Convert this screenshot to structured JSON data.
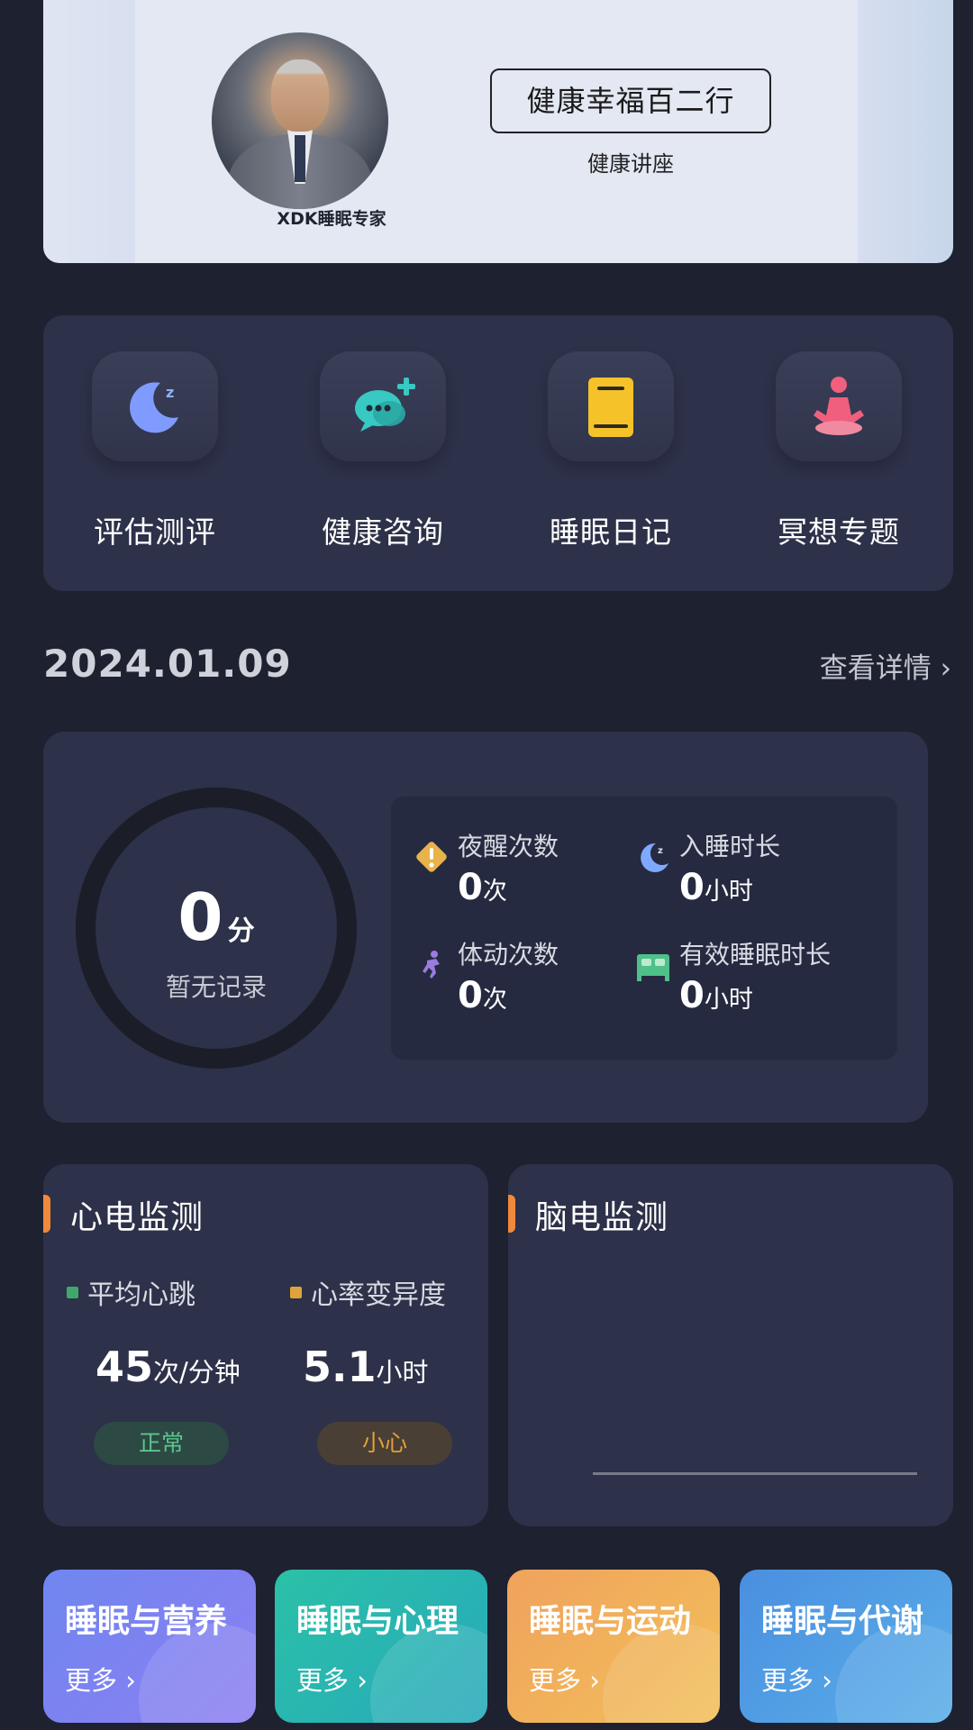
{
  "banner": {
    "expert_name": "XDK睡眠专家",
    "title": "健康幸福百二行",
    "subtitle": "健康讲座"
  },
  "features": [
    {
      "label": "评估测评",
      "icon": "moon-sleep-icon"
    },
    {
      "label": "健康咨询",
      "icon": "chat-plus-icon"
    },
    {
      "label": "睡眠日记",
      "icon": "diary-book-icon"
    },
    {
      "label": "冥想专题",
      "icon": "meditation-icon"
    }
  ],
  "date_row": {
    "date": "2024.01.09",
    "details_label": "查看详情 ›"
  },
  "summary": {
    "score": "0",
    "score_unit": "分",
    "status": "暂无记录",
    "stats": [
      {
        "title": "夜醒次数",
        "value": "0",
        "unit": "次",
        "icon": "warning-icon"
      },
      {
        "title": "入睡时长",
        "value": "0",
        "unit": "小时",
        "icon": "moon-icon"
      },
      {
        "title": "体动次数",
        "value": "0",
        "unit": "次",
        "icon": "running-person-icon"
      },
      {
        "title": "有效睡眠时长",
        "value": "0",
        "unit": "小时",
        "icon": "bed-icon"
      }
    ]
  },
  "ecg": {
    "title": "心电监测",
    "metrics": [
      {
        "label": "平均心跳",
        "value": "45",
        "unit": "次/分钟",
        "badge": "正常",
        "dot_color": "#3ea86b"
      },
      {
        "label": "心率变异度",
        "value": "5.1",
        "unit": "小时",
        "badge": "小心",
        "dot_color": "#e0a23a"
      }
    ]
  },
  "eeg": {
    "title": "脑电监测"
  },
  "topics": [
    {
      "title": "睡眠与营养",
      "more": "更多 ›"
    },
    {
      "title": "睡眠与心理",
      "more": "更多 ›"
    },
    {
      "title": "睡眠与运动",
      "more": "更多 ›"
    },
    {
      "title": "睡眠与代谢",
      "more": "更多 ›"
    }
  ],
  "colors": {
    "background": "#1e2130",
    "card": "#2d3149",
    "accent": "#f0893c"
  }
}
